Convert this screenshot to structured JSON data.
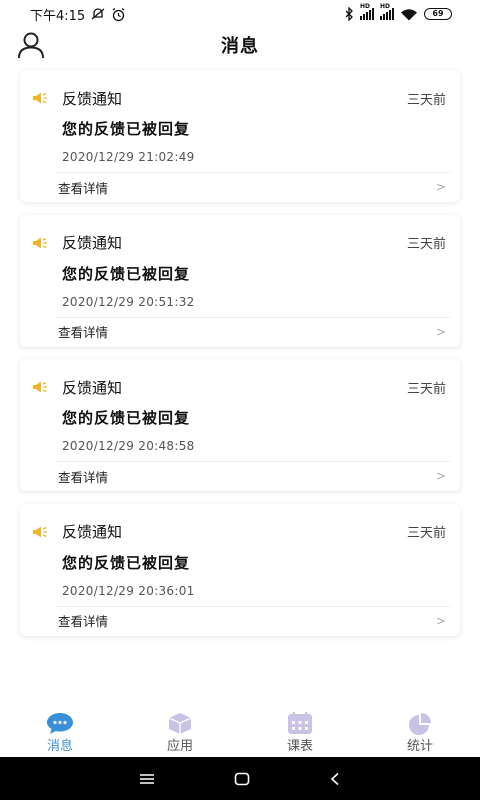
{
  "status_bar": {
    "time": "下午4:15",
    "signal_label_1": "HD",
    "signal_label_2": "HD",
    "battery": "69"
  },
  "header": {
    "title": "消息"
  },
  "messages": [
    {
      "type": "反馈通知",
      "time_ago": "三天前",
      "title": "您的反馈已被回复",
      "date": "2020/12/29 21:02:49",
      "detail_label": "查看详情",
      "chevron": ">"
    },
    {
      "type": "反馈通知",
      "time_ago": "三天前",
      "title": "您的反馈已被回复",
      "date": "2020/12/29 20:51:32",
      "detail_label": "查看详情",
      "chevron": ">"
    },
    {
      "type": "反馈通知",
      "time_ago": "三天前",
      "title": "您的反馈已被回复",
      "date": "2020/12/29 20:48:58",
      "detail_label": "查看详情",
      "chevron": ">"
    },
    {
      "type": "反馈通知",
      "time_ago": "三天前",
      "title": "您的反馈已被回复",
      "date": "2020/12/29 20:36:01",
      "detail_label": "查看详情",
      "chevron": ">"
    }
  ],
  "tabbar": {
    "tabs": [
      {
        "label": "消息",
        "icon": "chat-bubble-icon",
        "active": true
      },
      {
        "label": "应用",
        "icon": "cube-icon",
        "active": false
      },
      {
        "label": "课表",
        "icon": "calendar-icon",
        "active": false
      },
      {
        "label": "统计",
        "icon": "pie-chart-icon",
        "active": false
      }
    ]
  },
  "colors": {
    "accent": "#3a8fd8",
    "icon_inactive": "#c9c2e6",
    "speaker": "#f0b429"
  }
}
